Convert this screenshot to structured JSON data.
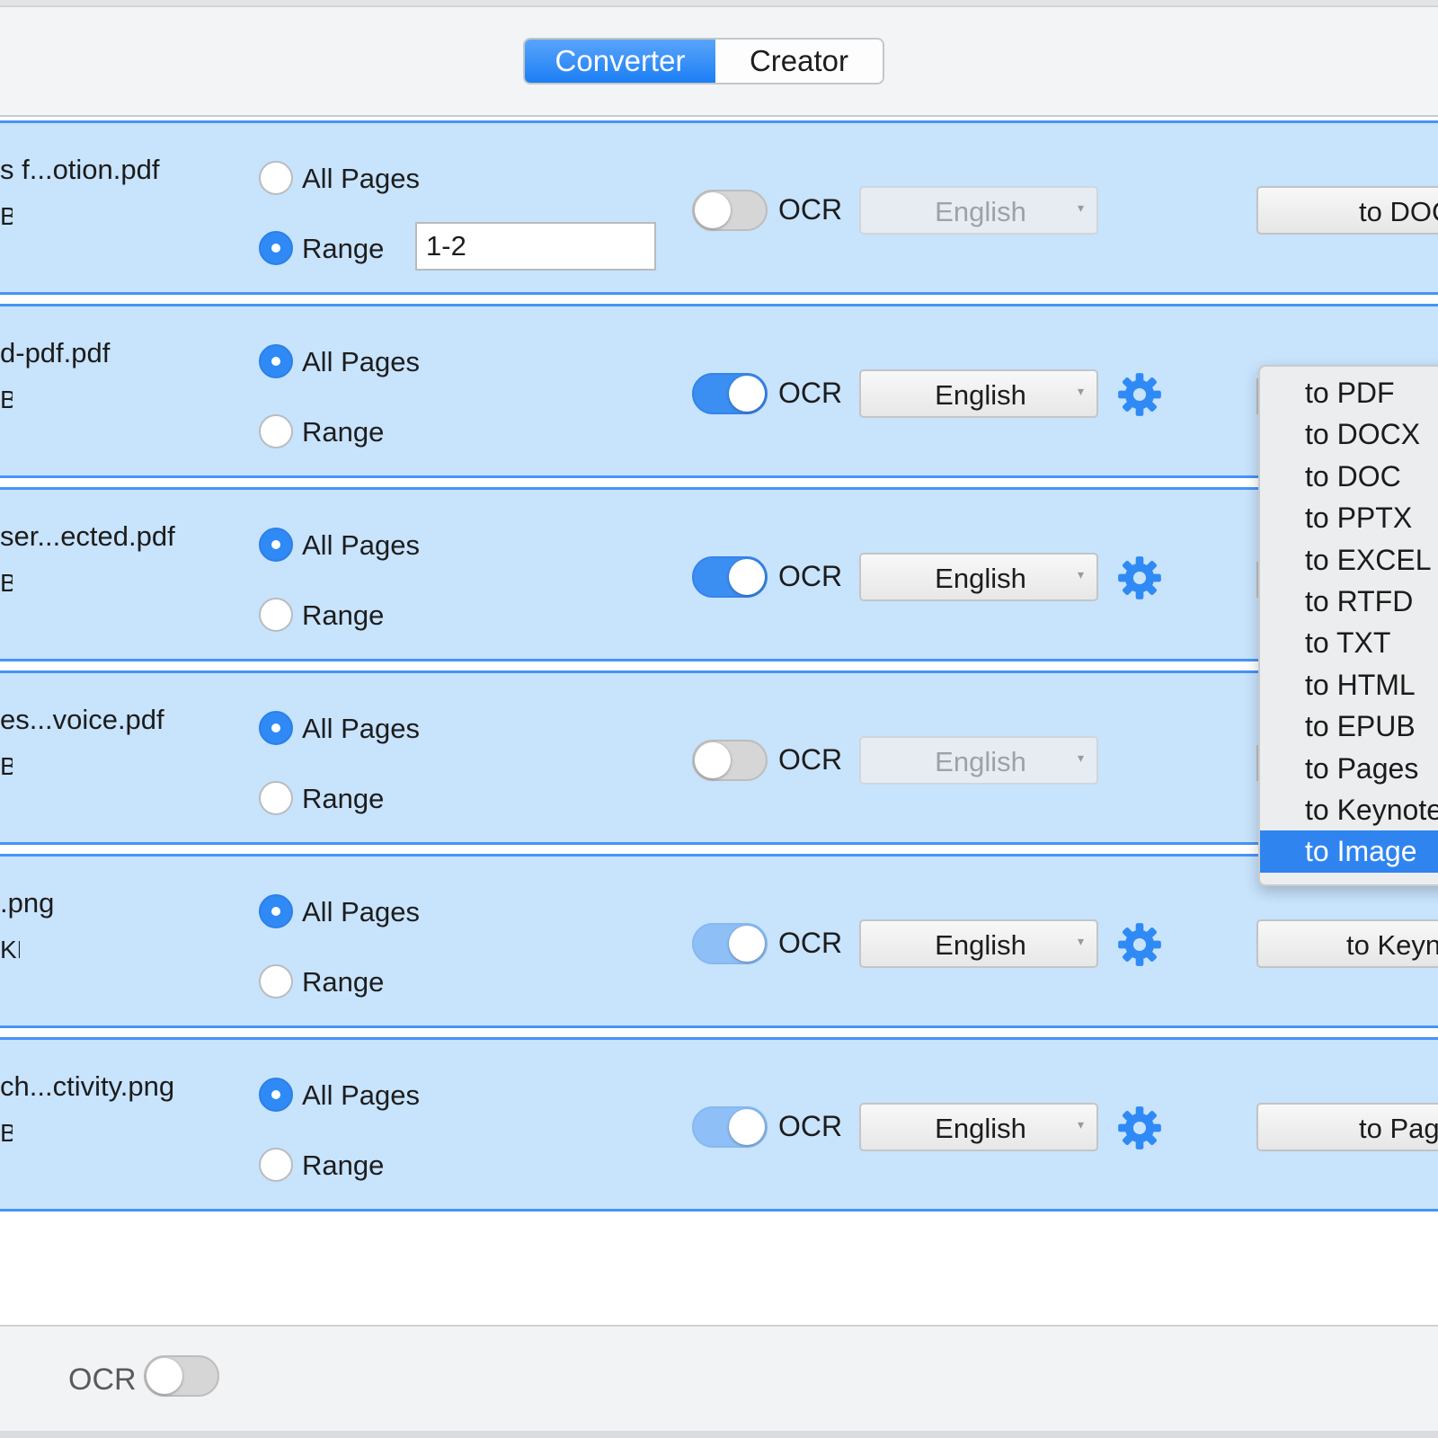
{
  "header": {
    "tabs": [
      {
        "label": "Converter",
        "active": true
      },
      {
        "label": "Creator",
        "active": false
      }
    ]
  },
  "labels": {
    "all_pages": "All Pages",
    "range": "Range",
    "ocr": "OCR"
  },
  "files": [
    {
      "name": "s f...otion.pdf",
      "size": "B",
      "page_mode": "range",
      "range_value": "1-2",
      "ocr": false,
      "language": "English",
      "format_button": "to DOC"
    },
    {
      "name": "d-pdf.pdf",
      "size": "B",
      "page_mode": "all",
      "ocr": true,
      "language": "English"
    },
    {
      "name": "ser...ected.pdf",
      "size": "B",
      "page_mode": "all",
      "ocr": true,
      "language": "English"
    },
    {
      "name": "es...voice.pdf",
      "size": "B",
      "page_mode": "all",
      "ocr": false,
      "language": "English"
    },
    {
      "name": ".png",
      "size": "KB",
      "page_mode": "all",
      "ocr": true,
      "language": "English",
      "format_button": "to Keyn"
    },
    {
      "name": "ch...ctivity.png",
      "size": "B",
      "page_mode": "all",
      "ocr": true,
      "language": "English",
      "format_button": "to Pag"
    }
  ],
  "format_menu": {
    "items": [
      "to PDF",
      "to DOCX",
      "to DOC",
      "to PPTX",
      "to EXCEL",
      "to RTFD",
      "to TXT",
      "to HTML",
      "to EPUB",
      "to Pages",
      "to Keynote",
      "to Image"
    ],
    "selected": "to Image"
  },
  "footer": {
    "ocr_label": "OCR",
    "ocr_enabled": false
  },
  "colors": {
    "accent": "#2f8af5",
    "row_background": "#c8e3fc",
    "row_border": "#4694f6"
  }
}
